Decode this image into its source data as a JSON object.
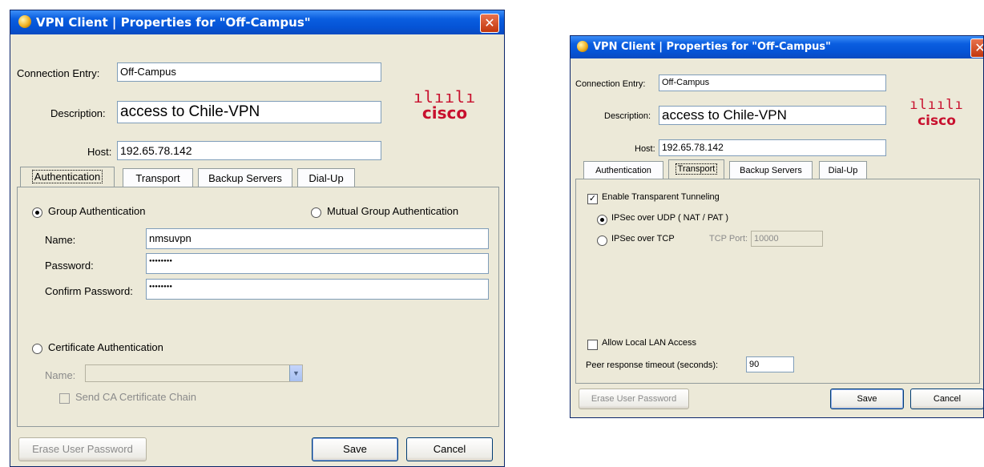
{
  "dialogs": [
    {
      "title": "VPN Client  |  Properties for \"Off-Campus\"",
      "close": "✕",
      "connection_entry_label": "Connection Entry:",
      "connection_entry_value": "Off-Campus",
      "description_label": "Description:",
      "description_value": "access to Chile-VPN",
      "host_label": "Host:",
      "host_value": "192.65.78.142",
      "logo": {
        "bars": "ılıılı",
        "word": "cisco"
      },
      "tabs": [
        "Authentication",
        "Transport",
        "Backup Servers",
        "Dial-Up"
      ],
      "active_tab": "Authentication",
      "auth": {
        "group_auth": "Group Authentication",
        "mutual_group_auth": "Mutual Group Authentication",
        "name_label": "Name:",
        "name_value": "nmsuvpn",
        "password_label": "Password:",
        "password_value": "●●●●●●●●",
        "confirm_label": "Confirm Password:",
        "confirm_value": "●●●●●●●●",
        "cert_auth": "Certificate Authentication",
        "cert_name_label": "Name:",
        "send_ca": "Send CA Certificate Chain"
      },
      "buttons": {
        "erase": "Erase User Password",
        "save": "Save",
        "cancel": "Cancel"
      }
    },
    {
      "title": "VPN Client  |  Properties for \"Off-Campus\"",
      "connection_entry_label": "Connection Entry:",
      "connection_entry_value": "Off-Campus",
      "description_label": "Description:",
      "description_value": "access to Chile-VPN",
      "host_label": "Host:",
      "host_value": "192.65.78.142",
      "logo": {
        "bars": "ılıılı",
        "word": "cisco"
      },
      "tabs": [
        "Authentication",
        "Transport",
        "Backup Servers",
        "Dial-Up"
      ],
      "active_tab": "Transport",
      "transport": {
        "enable_tunneling": "Enable Transparent Tunneling",
        "ipsec_udp": "IPSec over UDP ( NAT / PAT )",
        "ipsec_tcp": "IPSec over TCP",
        "tcp_port_label": "TCP Port:",
        "tcp_port_value": "10000",
        "allow_lan": "Allow Local LAN Access",
        "peer_timeout_label": "Peer response timeout (seconds):",
        "peer_timeout_value": "90"
      },
      "buttons": {
        "erase": "Erase User Password",
        "save": "Save",
        "cancel": "Cancel"
      }
    }
  ]
}
